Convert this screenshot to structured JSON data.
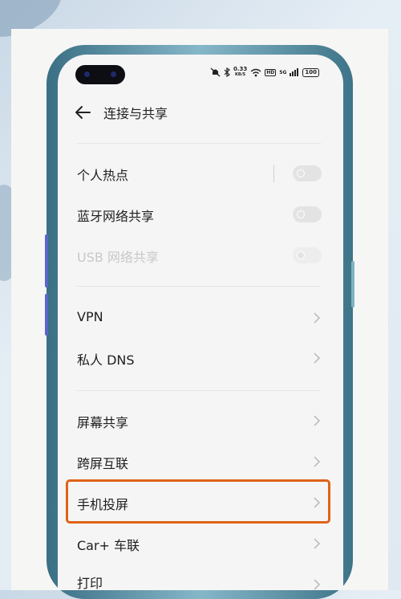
{
  "header": {
    "title": "连接与共享"
  },
  "status": {
    "speed_value": "0.33",
    "speed_unit": "KB/S",
    "hd": "HD",
    "network": "5G",
    "battery": "100"
  },
  "rows": [
    {
      "label": "个人热点",
      "control": "toggle",
      "state": "off"
    },
    {
      "label": "蓝牙网络共享",
      "control": "toggle",
      "state": "off"
    },
    {
      "label": "USB 网络共享",
      "control": "toggle",
      "state": "disabled"
    },
    {
      "label": "VPN",
      "control": "chevron"
    },
    {
      "label": "私人 DNS",
      "control": "chevron"
    },
    {
      "label": "屏幕共享",
      "control": "chevron"
    },
    {
      "label": "跨屏互联",
      "control": "chevron"
    },
    {
      "label": "手机投屏",
      "control": "chevron",
      "highlighted": true
    },
    {
      "label": "Car+ 车联",
      "control": "chevron"
    },
    {
      "label": "打印",
      "control": "chevron"
    }
  ],
  "colors": {
    "highlight": "#e06218",
    "phone_frame": "#3e7488"
  }
}
